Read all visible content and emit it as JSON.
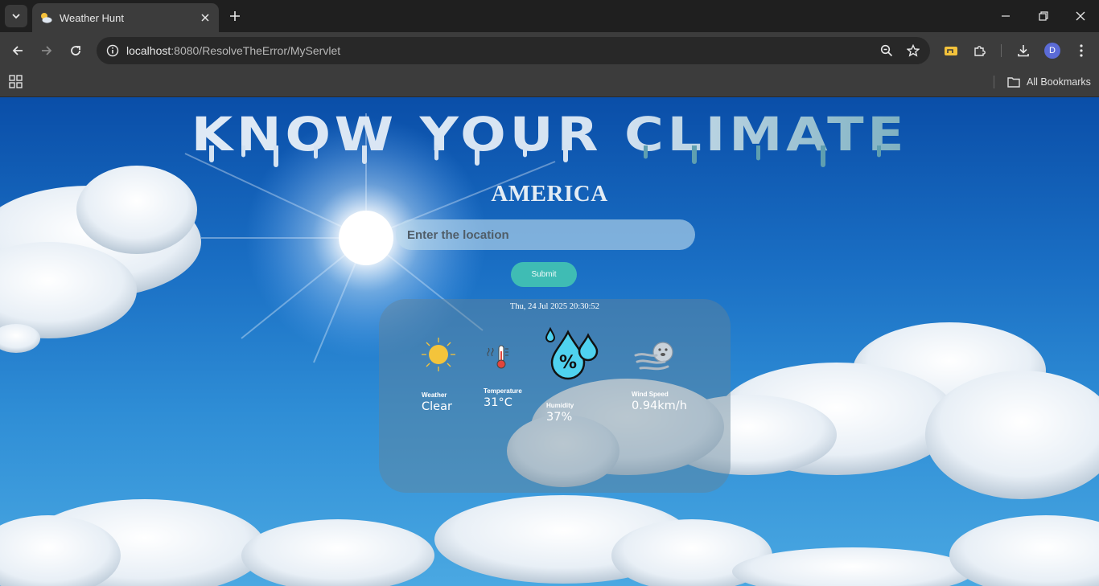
{
  "browser": {
    "tab_title": "Weather Hunt",
    "url_host": "localhost",
    "url_rest": ":8080/ResolveTheError/MyServlet",
    "bookmarks_label": "All Bookmarks",
    "profile_initial": "D"
  },
  "page": {
    "headline": "KNOW YOUR CLIMATE",
    "country": "AMERICA",
    "search_placeholder": "Enter the location",
    "submit_label": "Submit",
    "datetime": "Thu, 24 Jul 2025 20:30:52"
  },
  "metrics": {
    "weather": {
      "label": "Weather",
      "value": "Clear",
      "icon": "sun-icon"
    },
    "temperature": {
      "label": "Temperature",
      "value": "31°C",
      "icon": "thermometer-icon"
    },
    "humidity": {
      "label": "Humidity",
      "value": "37%",
      "icon": "humidity-drops-icon"
    },
    "wind": {
      "label": "Wind Speed",
      "value": "0.94km/h",
      "icon": "wind-icon"
    }
  },
  "colors": {
    "submit_button": "#3fbcb4",
    "card_overlay": "rgba(100,130,150,0.45)",
    "headline_gradient_end": "#2c7b8a"
  }
}
